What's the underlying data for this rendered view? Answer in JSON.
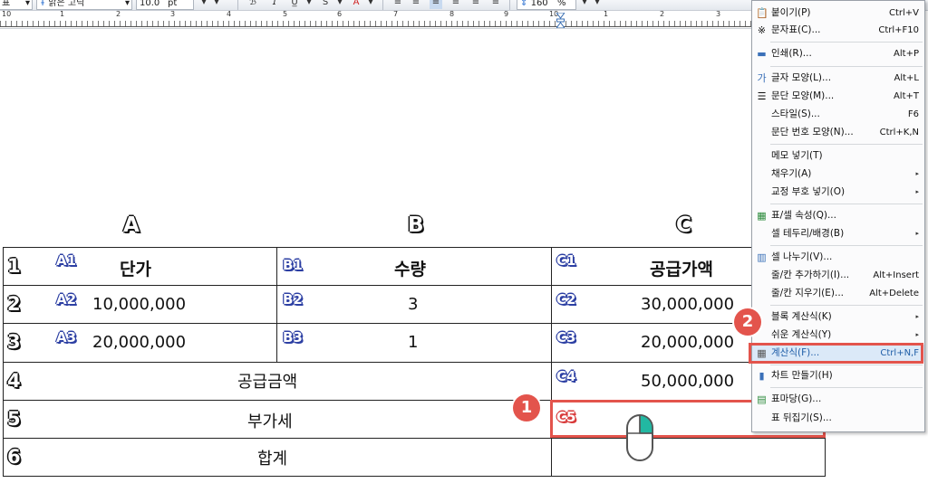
{
  "toolbar": {
    "style_value": "표",
    "font_value": "맑은 고딕",
    "size_value": "10.0",
    "size_unit": "pt",
    "zoom_value": "160",
    "zoom_unit": "%"
  },
  "ruler": {
    "labels": [
      "10",
      "1",
      "2",
      "3",
      "4",
      "5",
      "6",
      "7",
      "8",
      "9",
      "10",
      "1",
      "2",
      "3"
    ]
  },
  "columns": [
    "A",
    "B",
    "C"
  ],
  "rows": [
    {
      "num": "1",
      "a_tag": "A1",
      "a": "단가",
      "b_tag": "B1",
      "b": "수량",
      "c_tag": "C1",
      "c": "공급가액"
    },
    {
      "num": "2",
      "a_tag": "A2",
      "a": "10,000,000",
      "b_tag": "B2",
      "b": "3",
      "c_tag": "C2",
      "c": "30,000,000"
    },
    {
      "num": "3",
      "a_tag": "A3",
      "a": "20,000,000",
      "b_tag": "B3",
      "b": "1",
      "c_tag": "C3",
      "c": "20,000,000"
    },
    {
      "num": "4",
      "ab": "공급금액",
      "c_tag": "C4",
      "c": "50,000,000"
    },
    {
      "num": "5",
      "ab": "부가세",
      "c_tag": "C5",
      "c": ""
    },
    {
      "num": "6",
      "ab": "합계",
      "c": ""
    }
  ],
  "badges": {
    "one": "1",
    "two": "2"
  },
  "context_menu": {
    "items": [
      {
        "label": "붙이기(P)",
        "shortcut": "Ctrl+V",
        "icon": "paste-icon"
      },
      {
        "label": "문자표(C)...",
        "shortcut": "Ctrl+F10",
        "icon": "symbol-icon"
      },
      {
        "label": "인쇄(R)...",
        "shortcut": "Alt+P",
        "icon": "print-icon"
      },
      {
        "label": "글자 모양(L)...",
        "shortcut": "Alt+L",
        "icon": "char-shape-icon"
      },
      {
        "label": "문단 모양(M)...",
        "shortcut": "Alt+T",
        "icon": "para-shape-icon"
      },
      {
        "label": "스타일(S)...",
        "shortcut": "F6"
      },
      {
        "label": "문단 번호 모양(N)...",
        "shortcut": "Ctrl+K,N"
      },
      {
        "label": "메모 넣기(T)",
        "shortcut": ""
      },
      {
        "label": "채우기(A)",
        "shortcut": "",
        "submenu": true
      },
      {
        "label": "교정 부호 넣기(O)",
        "shortcut": "",
        "submenu": true
      },
      {
        "label": "표/셀 속성(Q)...",
        "shortcut": "",
        "icon": "table-props-icon"
      },
      {
        "label": "셀 테두리/배경(B)",
        "shortcut": "",
        "submenu": true
      },
      {
        "label": "셀 나누기(V)...",
        "shortcut": "",
        "icon": "split-cell-icon"
      },
      {
        "label": "줄/칸 추가하기(I)...",
        "shortcut": "Alt+Insert"
      },
      {
        "label": "줄/칸 지우기(E)...",
        "shortcut": "Alt+Delete"
      },
      {
        "label": "블록 계산식(K)",
        "shortcut": "",
        "submenu": true
      },
      {
        "label": "쉬운 계산식(Y)",
        "shortcut": "",
        "submenu": true
      },
      {
        "label": "계산식(F)...",
        "shortcut": "Ctrl+N,F",
        "icon": "formula-icon"
      },
      {
        "label": "차트 만들기(H)",
        "shortcut": "",
        "icon": "chart-icon"
      },
      {
        "label": "표마당(G)...",
        "shortcut": "",
        "icon": "table-template-icon"
      },
      {
        "label": "표 뒤집기(S)...",
        "shortcut": ""
      }
    ]
  }
}
